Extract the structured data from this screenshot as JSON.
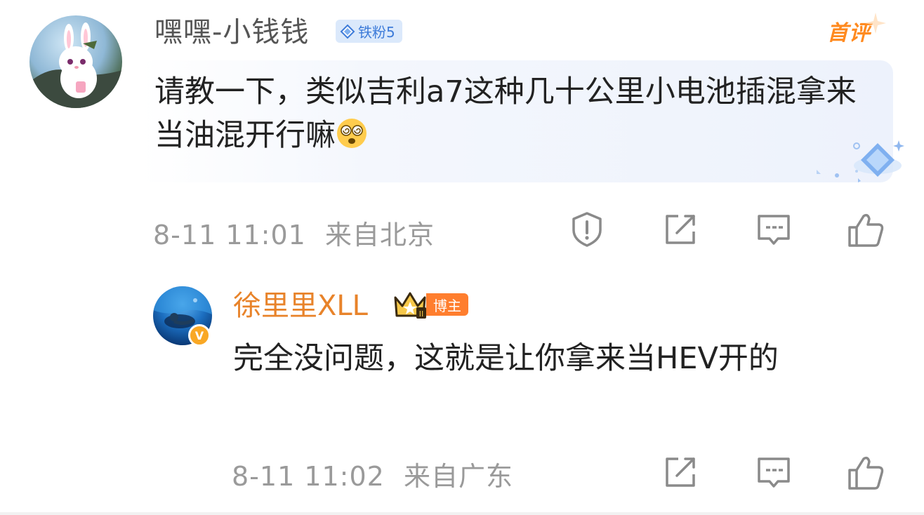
{
  "main_comment": {
    "username": "嘿嘿-小钱钱",
    "fan_badge": "铁粉5",
    "first_comment_label": "首评",
    "text": "请教一下，类似吉利a7这种几十公里小电池插混拿来当油混开行嘛",
    "emoji": "dizzy-face-emoji",
    "time": "8-11 11:01",
    "location": "来自北京"
  },
  "reply": {
    "username": "徐里里XLL",
    "role_badge": "博主",
    "text": "完全没问题，这就是让你拿来当HEV开的",
    "time": "8-11 11:02",
    "location": "来自广东"
  },
  "colors": {
    "username_grey": "#555555",
    "reply_username": "#e8832a",
    "meta_grey": "#9a9a9a",
    "fan_badge_bg": "#dbe9fb",
    "fan_badge_text": "#3d7bd9",
    "first_comment": "#ff8a1f",
    "blogger_badge": "#ff7e2e"
  },
  "icons": {
    "report": "report-icon",
    "share": "share-icon",
    "comment": "comment-icon",
    "like": "thumbs-up-icon"
  }
}
